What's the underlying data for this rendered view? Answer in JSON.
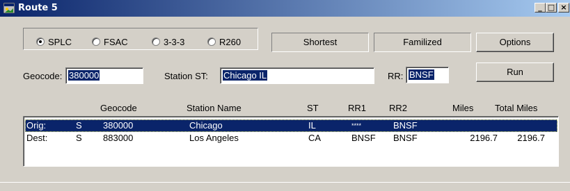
{
  "window": {
    "title": "Route 5",
    "min_glyph": "_",
    "max_glyph": "□",
    "close_glyph": "×"
  },
  "codetype": {
    "options": [
      {
        "label": "SPLC",
        "selected": true
      },
      {
        "label": "FSAC",
        "selected": false
      },
      {
        "label": "3-3-3",
        "selected": false
      },
      {
        "label": "R260",
        "selected": false
      }
    ]
  },
  "toolbar": {
    "shortest": "Shortest",
    "familized": "Familized",
    "options": "Options",
    "run": "Run"
  },
  "form": {
    "geocode_label": "Geocode:",
    "geocode_value": "380000",
    "station_label": "Station ST:",
    "station_value": "Chicago IL",
    "rr_label": "RR:",
    "rr_value": "BNSF"
  },
  "table": {
    "headers": [
      "Geocode",
      "Station Name",
      "ST",
      "RR1",
      "RR2",
      "Miles",
      "Total Miles"
    ],
    "rows": [
      {
        "type": "Orig:",
        "flag": "S",
        "geocode": "380000",
        "station": "Chicago",
        "st": "IL",
        "rr1": "****",
        "rr2": "BNSF",
        "miles": "",
        "total": "",
        "selected": true
      },
      {
        "type": "Dest:",
        "flag": "S",
        "geocode": "883000",
        "station": "Los Angeles",
        "st": "CA",
        "rr1": "BNSF",
        "rr2": "BNSF",
        "miles": "2196.7",
        "total": "2196.7",
        "selected": false
      }
    ]
  },
  "colors": {
    "titlebar_start": "#0a246a",
    "titlebar_end": "#a6caf0",
    "selection": "#0a246a",
    "face": "#d4d0c8"
  }
}
